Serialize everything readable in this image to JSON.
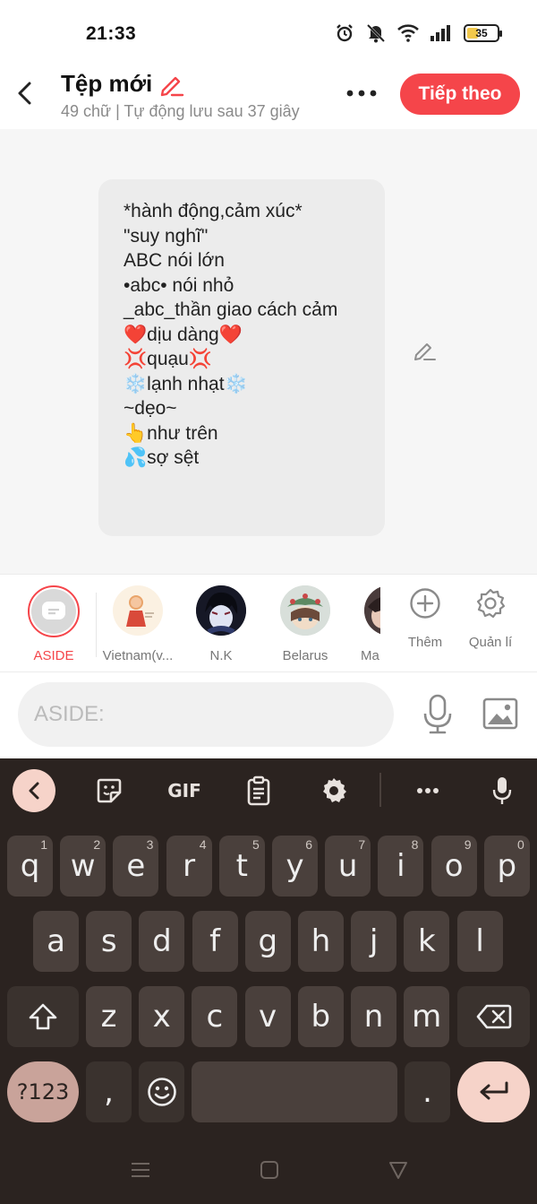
{
  "status_bar": {
    "time": "21:33",
    "battery": "35"
  },
  "header": {
    "title": "Tệp mới",
    "subtitle": "49 chữ | Tự động lưu sau 37 giây",
    "next_label": "Tiếp theo"
  },
  "message": {
    "lines": [
      "*hành động,cảm xúc*",
      "\"suy nghĩ\"",
      "ABC nói lớn",
      "•abc• nói nhỏ",
      "_abc_thần giao cách cảm",
      "❤️dịu dàng❤️",
      "💢quạu💢",
      "❄️lạnh nhạt❄️",
      "~dẹo~",
      "👆như trên",
      "💦sợ sệt"
    ]
  },
  "characters": [
    {
      "name": "ASIDE",
      "selected": true
    },
    {
      "name": "Vietnam(v..."
    },
    {
      "name": "N.K"
    },
    {
      "name": "Belarus"
    },
    {
      "name": "Ma"
    }
  ],
  "actions": {
    "add_label": "Thêm",
    "manage_label": "Quản lí"
  },
  "input": {
    "placeholder": "ASIDE:"
  },
  "keyboard": {
    "row1": [
      {
        "k": "q",
        "h": "1"
      },
      {
        "k": "w",
        "h": "2"
      },
      {
        "k": "e",
        "h": "3"
      },
      {
        "k": "r",
        "h": "4"
      },
      {
        "k": "t",
        "h": "5"
      },
      {
        "k": "y",
        "h": "6"
      },
      {
        "k": "u",
        "h": "7"
      },
      {
        "k": "i",
        "h": "8"
      },
      {
        "k": "o",
        "h": "9"
      },
      {
        "k": "p",
        "h": "0"
      }
    ],
    "row2": [
      "a",
      "s",
      "d",
      "f",
      "g",
      "h",
      "j",
      "k",
      "l"
    ],
    "row3": [
      "z",
      "x",
      "c",
      "v",
      "b",
      "n",
      "m"
    ],
    "symbols_label": "?123",
    "comma": ",",
    "period": ".",
    "gif_label": "GIF"
  },
  "colors": {
    "accent": "#f5454a",
    "keyboard_bg": "#2b2320",
    "key_bg": "#4a403c"
  }
}
